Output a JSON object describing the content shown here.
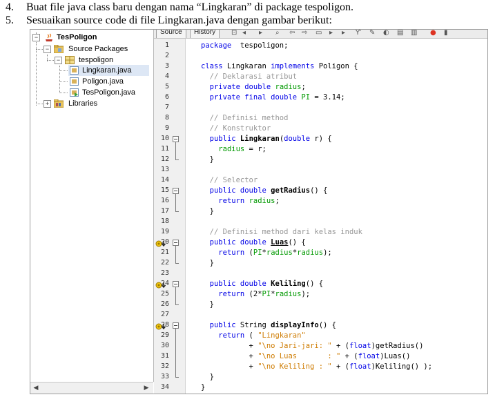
{
  "instructions": [
    {
      "num": "4.",
      "text": "Buat file java class baru dengan nama “Lingkaran” di package tespoligon."
    },
    {
      "num": "5.",
      "text": "Sesuaikan source code di file Lingkaran.java dengan gambar berikut:"
    }
  ],
  "toolbar": {
    "source_tab": "Source",
    "history_tab": "History"
  },
  "project_tree": {
    "project": "TesPoligon",
    "source_packages": "Source Packages",
    "package": "tespoligon",
    "files": [
      "Lingkaran.java",
      "Poligon.java",
      "TesPoligon.java"
    ],
    "libraries": "Libraries"
  },
  "colors": {
    "keyword": "#0000e6",
    "comment": "#969696",
    "field": "#009900",
    "string": "#ce7b00"
  },
  "code_lines": [
    {
      "n": "1",
      "t": [
        [
          "kw",
          "package"
        ],
        [
          "",
          "  tespoligon;"
        ]
      ]
    },
    {
      "n": "2",
      "t": []
    },
    {
      "n": "3",
      "t": [
        [
          "kw",
          "class"
        ],
        [
          "",
          " Lingkaran "
        ],
        [
          "kw",
          "implements"
        ],
        [
          "",
          " Poligon {"
        ]
      ]
    },
    {
      "n": "4",
      "t": [
        [
          "",
          "  "
        ],
        [
          "cm",
          "// Deklarasi atribut"
        ]
      ]
    },
    {
      "n": "5",
      "t": [
        [
          "",
          "  "
        ],
        [
          "kw",
          "private double"
        ],
        [
          "",
          " "
        ],
        [
          "fd",
          "radius"
        ],
        [
          "",
          ";"
        ]
      ]
    },
    {
      "n": "6",
      "t": [
        [
          "",
          "  "
        ],
        [
          "kw",
          "private final double"
        ],
        [
          "",
          " "
        ],
        [
          "fd",
          "PI"
        ],
        [
          "",
          " = 3.14;"
        ]
      ]
    },
    {
      "n": "7",
      "t": []
    },
    {
      "n": "8",
      "t": [
        [
          "",
          "  "
        ],
        [
          "cm",
          "// Definisi method"
        ]
      ]
    },
    {
      "n": "9",
      "t": [
        [
          "",
          "  "
        ],
        [
          "cm",
          "// Konstruktor"
        ]
      ]
    },
    {
      "n": "10",
      "t": [
        [
          "",
          "  "
        ],
        [
          "kw",
          "public"
        ],
        [
          "",
          " "
        ],
        [
          "b",
          "Lingkaran"
        ],
        [
          "",
          "("
        ],
        [
          "kw",
          "double"
        ],
        [
          "",
          " r) {"
        ]
      ]
    },
    {
      "n": "11",
      "t": [
        [
          "",
          "    "
        ],
        [
          "fd",
          "radius"
        ],
        [
          "",
          " = r;"
        ]
      ]
    },
    {
      "n": "12",
      "t": [
        [
          "",
          "  }"
        ]
      ]
    },
    {
      "n": "13",
      "t": []
    },
    {
      "n": "14",
      "t": [
        [
          "",
          "  "
        ],
        [
          "cm",
          "// Selector"
        ]
      ]
    },
    {
      "n": "15",
      "t": [
        [
          "",
          "  "
        ],
        [
          "kw",
          "public double"
        ],
        [
          "",
          " "
        ],
        [
          "b",
          "getRadius"
        ],
        [
          "",
          "() {"
        ]
      ]
    },
    {
      "n": "16",
      "t": [
        [
          "",
          "    "
        ],
        [
          "kw",
          "return"
        ],
        [
          "",
          " "
        ],
        [
          "fd",
          "radius"
        ],
        [
          "",
          ";"
        ]
      ]
    },
    {
      "n": "17",
      "t": [
        [
          "",
          "  }"
        ]
      ]
    },
    {
      "n": "18",
      "t": []
    },
    {
      "n": "19",
      "t": [
        [
          "",
          "  "
        ],
        [
          "cm",
          "// Definisi method dari kelas induk"
        ]
      ]
    },
    {
      "n": "20",
      "t": [
        [
          "",
          "  "
        ],
        [
          "kw",
          "public double"
        ],
        [
          "",
          " "
        ],
        [
          "bu",
          "Luas"
        ],
        [
          "",
          "() {"
        ]
      ]
    },
    {
      "n": "21",
      "t": [
        [
          "",
          "    "
        ],
        [
          "kw",
          "return"
        ],
        [
          "",
          " ("
        ],
        [
          "fd",
          "PI"
        ],
        [
          "",
          "*"
        ],
        [
          "fd",
          "radius"
        ],
        [
          "",
          "*"
        ],
        [
          "fd",
          "radius"
        ],
        [
          "",
          ");"
        ]
      ]
    },
    {
      "n": "22",
      "t": [
        [
          "",
          "  }"
        ]
      ]
    },
    {
      "n": "23",
      "t": []
    },
    {
      "n": "24",
      "t": [
        [
          "",
          "  "
        ],
        [
          "kw",
          "public double"
        ],
        [
          "",
          " "
        ],
        [
          "b",
          "Keliling"
        ],
        [
          "",
          "() {"
        ]
      ]
    },
    {
      "n": "25",
      "t": [
        [
          "",
          "    "
        ],
        [
          "kw",
          "return"
        ],
        [
          "",
          " (2*"
        ],
        [
          "fd",
          "PI"
        ],
        [
          "",
          "*"
        ],
        [
          "fd",
          "radius"
        ],
        [
          "",
          ");"
        ]
      ]
    },
    {
      "n": "26",
      "t": [
        [
          "",
          "  }"
        ]
      ]
    },
    {
      "n": "27",
      "t": []
    },
    {
      "n": "28",
      "t": [
        [
          "",
          "  "
        ],
        [
          "kw",
          "public"
        ],
        [
          "",
          " String "
        ],
        [
          "b",
          "displayInfo"
        ],
        [
          "",
          "() {"
        ]
      ]
    },
    {
      "n": "29",
      "t": [
        [
          "",
          "    "
        ],
        [
          "kw",
          "return"
        ],
        [
          "",
          " ( "
        ],
        [
          "st",
          "\"Lingkaran\""
        ]
      ]
    },
    {
      "n": "30",
      "t": [
        [
          "",
          "           + "
        ],
        [
          "st",
          "\"\\no Jari-jari: \""
        ],
        [
          "",
          " + ("
        ],
        [
          "kw",
          "float"
        ],
        [
          "",
          ")getRadius()"
        ]
      ]
    },
    {
      "n": "31",
      "t": [
        [
          "",
          "           + "
        ],
        [
          "st",
          "\"\\no Luas       : \""
        ],
        [
          "",
          " + ("
        ],
        [
          "kw",
          "float"
        ],
        [
          "",
          ")Luas()"
        ]
      ]
    },
    {
      "n": "32",
      "t": [
        [
          "",
          "           + "
        ],
        [
          "st",
          "\"\\no Keliling : \""
        ],
        [
          "",
          " + ("
        ],
        [
          "kw",
          "float"
        ],
        [
          "",
          ")Keliling() );"
        ]
      ]
    },
    {
      "n": "33",
      "t": [
        [
          "",
          "  }"
        ]
      ]
    },
    {
      "n": "34",
      "t": [
        [
          "",
          "}"
        ]
      ]
    }
  ]
}
